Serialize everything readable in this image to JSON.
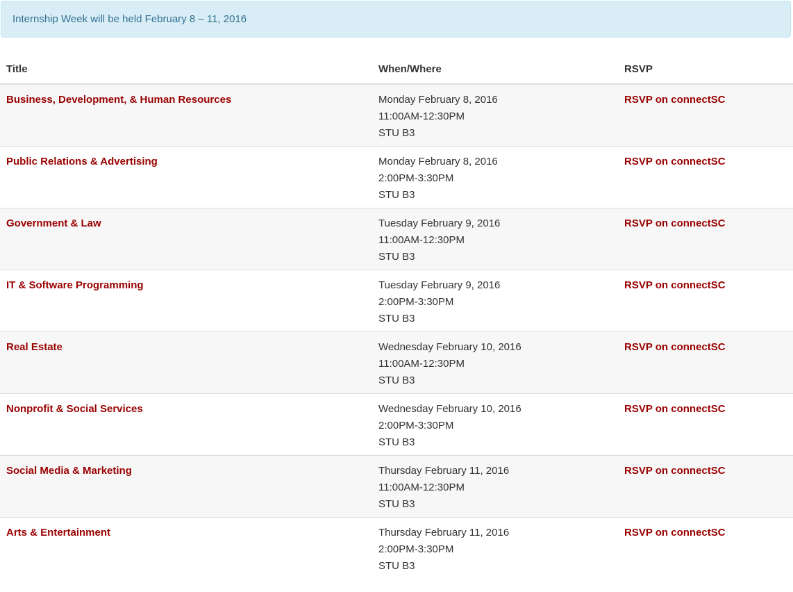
{
  "notice": "Internship Week will be held February 8 – 11, 2016",
  "table": {
    "headers": {
      "title": "Title",
      "when": "When/Where",
      "rsvp": "RSVP"
    },
    "rows": [
      {
        "title": "Business, Development, & Human Resources",
        "date": "Monday February 8, 2016",
        "time": "11:00AM-12:30PM",
        "location": "STU B3",
        "rsvp": "RSVP on connectSC"
      },
      {
        "title": "Public Relations & Advertising",
        "date": "Monday February 8, 2016",
        "time": "2:00PM-3:30PM",
        "location": "STU B3",
        "rsvp": "RSVP on connectSC"
      },
      {
        "title": "Government & Law",
        "date": "Tuesday February 9, 2016",
        "time": "11:00AM-12:30PM",
        "location": "STU B3",
        "rsvp": "RSVP on connectSC"
      },
      {
        "title": "IT & Software Programming",
        "date": "Tuesday February 9, 2016",
        "time": "2:00PM-3:30PM",
        "location": "STU B3",
        "rsvp": "RSVP on connectSC"
      },
      {
        "title": "Real Estate",
        "date": "Wednesday February 10, 2016",
        "time": "11:00AM-12:30PM",
        "location": "STU B3",
        "rsvp": "RSVP on connectSC"
      },
      {
        "title": "Nonprofit & Social Services",
        "date": "Wednesday February 10, 2016",
        "time": "2:00PM-3:30PM",
        "location": "STU B3",
        "rsvp": "RSVP on connectSC"
      },
      {
        "title": "Social Media & Marketing",
        "date": "Thursday February 11, 2016",
        "time": "11:00AM-12:30PM",
        "location": "STU B3",
        "rsvp": "RSVP on connectSC"
      },
      {
        "title": "Arts & Entertainment",
        "date": "Thursday February 11, 2016",
        "time": "2:00PM-3:30PM",
        "location": "STU B3",
        "rsvp": "RSVP on connectSC"
      }
    ]
  },
  "colors": {
    "link": "#990000",
    "alert_background": "#d9edf7",
    "alert_text": "#31708f",
    "stripe": "#f7f7f7",
    "border": "#dddddd"
  }
}
